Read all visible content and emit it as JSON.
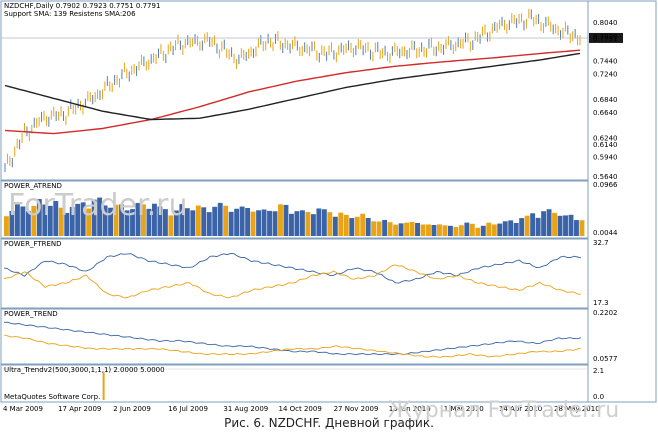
{
  "caption": "Рис. 6. NZDCHF. Дневной график.",
  "watermarks": {
    "top": "ForTrader.ru",
    "bottom": "Журнал ForTrader.ru"
  },
  "copyright": "MetaQuotes Software Corp.",
  "colors": {
    "up_bar": "#e8a317",
    "down_bar": "#4f7fb8",
    "sma_short": "#d42a2a",
    "sma_long": "#222222",
    "ind_a": "#3a63a8",
    "ind_b": "#e8a317",
    "frame": "#7f9fbf"
  },
  "chart_data": [
    {
      "type": "line",
      "panel": "main",
      "title": "NZDCHF,Daily  0.7902 0.7923 0.7751 0.7791",
      "subtitle": "Support SMA: 139 Resistens SMA:206",
      "current_price": "0.7791",
      "ylim": [
        0.564,
        0.818
      ],
      "y_ticks": [
        "0.8040",
        "0.7820",
        "0.7440",
        "0.7240",
        "0.6840",
        "0.6640",
        "0.6240",
        "0.6140",
        "0.5940",
        "0.5640"
      ],
      "x_ticks": [
        "4 Mar 2009",
        "17 Apr 2009",
        "2 Jun 2009",
        "16 Jul 2009",
        "31 Aug 2009",
        "14 Oct 2009",
        "27 Nov 2009",
        "13 Jan 2010",
        "1 Mar 2010",
        "14 Apr 2010",
        "28 May 2010"
      ],
      "series": [
        {
          "name": "Price",
          "x": [
            0,
            4,
            8,
            12,
            18,
            24,
            30,
            36,
            42,
            48,
            54,
            60,
            66,
            72,
            78,
            84,
            90,
            96,
            102,
            108,
            114,
            118
          ],
          "values": [
            0.575,
            0.63,
            0.655,
            0.66,
            0.685,
            0.72,
            0.745,
            0.77,
            0.775,
            0.745,
            0.775,
            0.765,
            0.755,
            0.765,
            0.755,
            0.76,
            0.765,
            0.775,
            0.8,
            0.81,
            0.79,
            0.78
          ]
        },
        {
          "name": "Resistens SMA",
          "x": [
            0,
            10,
            20,
            30,
            40,
            50,
            60,
            70,
            80,
            90,
            100,
            110,
            118
          ],
          "values": [
            0.635,
            0.63,
            0.638,
            0.652,
            0.672,
            0.695,
            0.712,
            0.725,
            0.735,
            0.742,
            0.748,
            0.755,
            0.76
          ]
        },
        {
          "name": "Support SMA",
          "x": [
            0,
            10,
            20,
            30,
            40,
            50,
            60,
            70,
            80,
            90,
            100,
            110,
            118
          ],
          "values": [
            0.705,
            0.685,
            0.665,
            0.652,
            0.654,
            0.668,
            0.685,
            0.702,
            0.715,
            0.725,
            0.735,
            0.745,
            0.755
          ]
        }
      ]
    },
    {
      "type": "bar",
      "panel": "power_atrend",
      "title": "POWER_ATREND",
      "y_ticks": [
        "0.0966",
        "0.0044"
      ],
      "ylim": [
        0,
        0.0966
      ],
      "values": [
        0.05,
        0.062,
        0.058,
        0.07,
        0.066,
        0.055,
        0.06,
        0.068,
        0.072,
        0.065,
        0.06,
        0.058,
        0.062,
        0.066,
        0.055,
        0.05,
        0.06,
        0.058,
        0.055,
        0.062,
        0.06,
        0.055,
        0.058,
        0.05,
        0.055,
        0.06,
        0.052,
        0.048,
        0.055,
        0.05,
        0.045,
        0.04,
        0.042,
        0.035,
        0.03,
        0.028,
        0.025,
        0.03,
        0.022,
        0.025,
        0.02,
        0.022,
        0.025,
        0.02,
        0.025,
        0.028,
        0.03,
        0.038,
        0.045,
        0.05,
        0.048,
        0.04,
        0.035
      ],
      "colors_pattern": "mixed"
    },
    {
      "type": "line",
      "panel": "power_ftrend",
      "title": "POWER_FTREND",
      "y_ticks": [
        "32.7",
        "17.3"
      ],
      "ylim": [
        17.3,
        32.7
      ],
      "series": [
        {
          "name": "A",
          "values": [
            27,
            25,
            29,
            28,
            26,
            30,
            31,
            29,
            28,
            27,
            30,
            31,
            29,
            28,
            27,
            26,
            25,
            27,
            26,
            23,
            24,
            26,
            25,
            27,
            28,
            29,
            27,
            30,
            30
          ]
        },
        {
          "name": "B",
          "values": [
            24,
            26,
            22,
            23,
            25,
            20,
            19,
            21,
            22,
            23,
            20,
            19,
            21,
            22,
            23,
            25,
            26,
            24,
            25,
            28,
            26,
            24,
            25,
            23,
            22,
            21,
            23,
            21,
            20
          ]
        }
      ]
    },
    {
      "type": "line",
      "panel": "power_trend",
      "title": "POWER_TREND",
      "y_ticks": [
        "0.2202",
        "0.0577"
      ],
      "ylim": [
        0.0577,
        0.2202
      ],
      "series": [
        {
          "name": "A",
          "values": [
            0.2,
            0.19,
            0.18,
            0.17,
            0.16,
            0.15,
            0.14,
            0.13,
            0.13,
            0.12,
            0.11,
            0.11,
            0.1,
            0.09,
            0.09,
            0.08,
            0.08,
            0.08,
            0.08,
            0.09,
            0.1,
            0.11,
            0.12,
            0.13,
            0.12,
            0.14,
            0.14
          ]
        },
        {
          "name": "B",
          "values": [
            0.15,
            0.14,
            0.12,
            0.11,
            0.1,
            0.1,
            0.1,
            0.1,
            0.09,
            0.08,
            0.08,
            0.08,
            0.09,
            0.1,
            0.1,
            0.11,
            0.1,
            0.09,
            0.08,
            0.07,
            0.07,
            0.08,
            0.07,
            0.08,
            0.09,
            0.09,
            0.1
          ]
        }
      ]
    },
    {
      "type": "bar",
      "panel": "ultra_trend",
      "title": "Ultra_Trendv2(500,3000,1,1,1) 2.0000 5.0000",
      "y_ticks": [
        "2.1",
        "0.0"
      ],
      "ylim": [
        0,
        2.1
      ],
      "values": [
        0,
        0,
        0,
        0,
        0,
        0,
        0,
        0,
        0,
        0,
        0,
        0,
        0,
        0,
        0,
        0,
        0,
        0,
        0,
        0,
        2.0,
        0,
        0,
        0,
        0,
        0,
        0,
        0,
        0,
        0,
        0,
        0,
        0,
        0,
        0,
        0,
        0,
        0,
        0,
        0,
        0,
        0,
        0,
        0,
        0,
        0,
        0,
        0,
        0,
        0,
        0,
        0,
        0,
        0,
        0,
        0,
        0,
        0,
        0,
        0,
        0,
        0,
        0,
        0,
        0,
        0,
        0,
        0,
        0,
        0,
        0,
        0,
        0,
        0,
        0,
        0,
        0,
        0,
        0,
        0,
        0,
        0,
        0,
        0,
        0,
        0,
        0,
        0,
        0,
        0,
        0,
        0,
        0,
        0,
        0,
        0,
        0,
        0,
        0,
        0,
        0,
        0,
        0,
        0,
        0,
        0,
        0,
        0,
        0,
        0,
        0,
        0,
        0,
        0,
        0,
        0,
        0,
        0
      ]
    }
  ]
}
